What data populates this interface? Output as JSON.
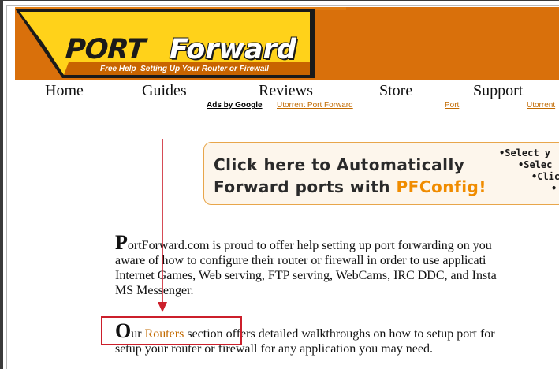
{
  "site": {
    "logo_port": "PORT",
    "logo_forward": "Forward",
    "tagline_lead": "Free Help",
    "tagline_rest": "Setting Up Your Router or Firewall"
  },
  "nav": {
    "items": [
      "Home",
      "Guides",
      "Reviews",
      "Store",
      "Support"
    ]
  },
  "ads": {
    "label": "Ads by Google",
    "links": [
      "Utorrent Port Forward",
      "Port",
      "Utorrent"
    ]
  },
  "promo": {
    "line1": "Click here to Automatically",
    "line2_prefix": "Forward ports with ",
    "line2_accent": "PFConfig!",
    "bullets": [
      "•Select y",
      "•Selec",
      "•Clic",
      "•"
    ]
  },
  "content": {
    "para1_cap": "P",
    "para1_lines": [
      "ortForward.com is proud to offer help setting up port forwarding on you",
      "aware of how to configure their router or firewall in order to use applicati",
      "Internet Games, Web serving, FTP serving, WebCams, IRC DDC, and Insta",
      "MS Messenger."
    ],
    "para2_cap": "O",
    "para2_before": "ur ",
    "para2_link": "Routers",
    "para2_after": " section offers detailed walkthroughs on how to setup port for",
    "para2_line2": "setup your router or firewall for any application you may need."
  },
  "colors": {
    "banner_orange": "#d9700b",
    "banner_yellow": "#ffd21a",
    "link_orange": "#c26a00",
    "annotation_red": "#cc1f2b"
  }
}
